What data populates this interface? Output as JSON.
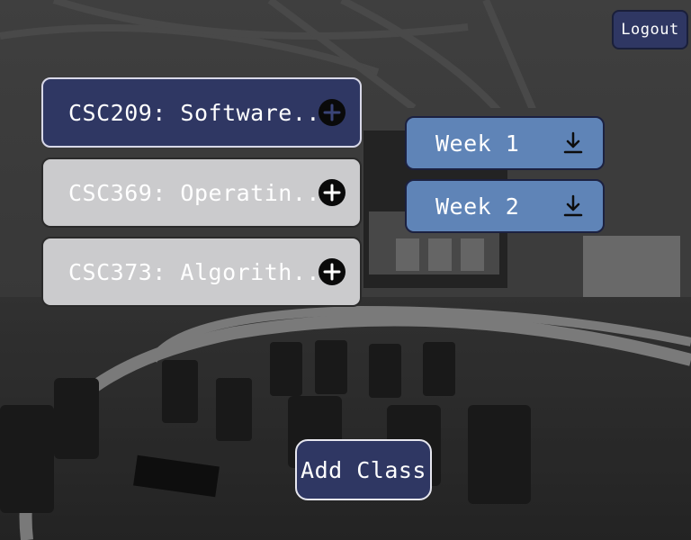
{
  "header": {
    "logout_label": "Logout"
  },
  "classes": [
    {
      "label": "CSC209: Software...",
      "selected": true
    },
    {
      "label": "CSC369: Operatin...",
      "selected": false
    },
    {
      "label": "CSC373: Algorith...",
      "selected": false
    }
  ],
  "weeks": [
    {
      "label": "Week 1"
    },
    {
      "label": "Week 2"
    }
  ],
  "footer": {
    "add_class_label": "Add Class"
  },
  "icons": {
    "class_add": "plus-icon",
    "week_download": "download-icon"
  },
  "colors": {
    "primary_navy": "#2f3763",
    "week_blue": "#5f84b7",
    "unselected_gray": "#cbcbcd"
  }
}
